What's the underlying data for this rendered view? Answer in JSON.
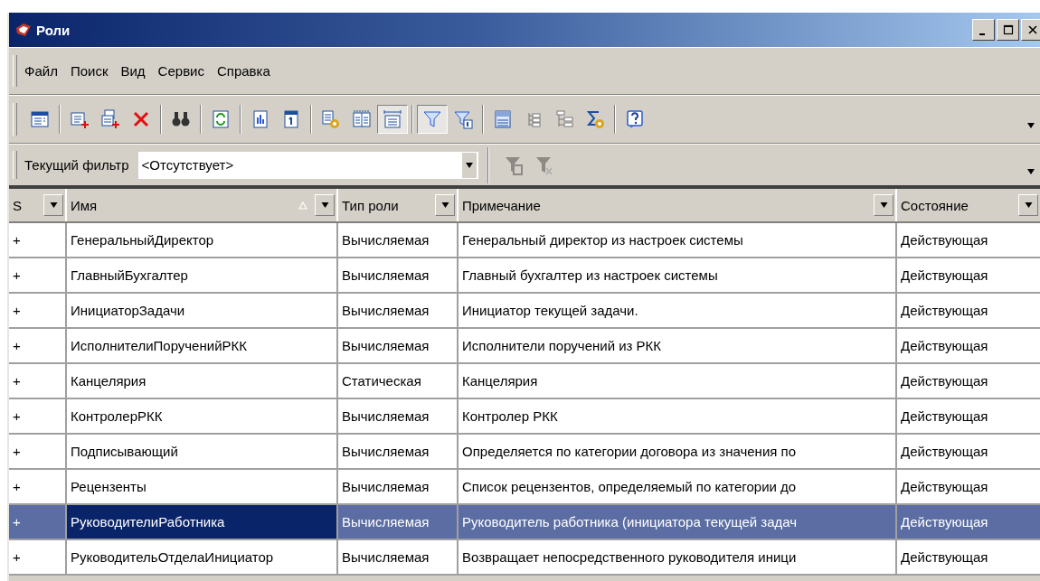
{
  "window": {
    "title": "Роли"
  },
  "menu": [
    {
      "label": "Файл"
    },
    {
      "label": "Поиск"
    },
    {
      "label": "Вид"
    },
    {
      "label": "Сервис"
    },
    {
      "label": "Справка"
    }
  ],
  "toolbar": [
    {
      "kind": "table",
      "pressed": false
    },
    {
      "kind": "separator"
    },
    {
      "kind": "add",
      "pressed": false
    },
    {
      "kind": "add-copy",
      "pressed": false
    },
    {
      "kind": "delete",
      "pressed": false
    },
    {
      "kind": "separator"
    },
    {
      "kind": "find",
      "pressed": false
    },
    {
      "kind": "separator"
    },
    {
      "kind": "refresh",
      "pressed": false
    },
    {
      "kind": "separator"
    },
    {
      "kind": "report",
      "pressed": false
    },
    {
      "kind": "calendar",
      "pressed": false
    },
    {
      "kind": "separator"
    },
    {
      "kind": "list-settings",
      "pressed": false
    },
    {
      "kind": "columns",
      "pressed": false
    },
    {
      "kind": "fit-width",
      "pressed": true
    },
    {
      "kind": "separator"
    },
    {
      "kind": "filter",
      "pressed": true
    },
    {
      "kind": "filter-value",
      "pressed": false
    },
    {
      "kind": "separator"
    },
    {
      "kind": "list",
      "pressed": false
    },
    {
      "kind": "tree",
      "pressed": false
    },
    {
      "kind": "tree-branch",
      "pressed": false
    },
    {
      "kind": "sigma",
      "pressed": false
    },
    {
      "kind": "separator"
    },
    {
      "kind": "help",
      "pressed": false
    }
  ],
  "filter_bar": {
    "label": "Текущий фильтр",
    "value": "<Отсутствует>",
    "set_filter_disabled": true,
    "clear_filter_disabled": true
  },
  "table": {
    "columns": [
      {
        "label": "S",
        "sorted_ascending": false
      },
      {
        "label": "Имя",
        "sorted_ascending": true
      },
      {
        "label": "Тип роли",
        "sorted_ascending": false
      },
      {
        "label": "Примечание",
        "sorted_ascending": false
      },
      {
        "label": "Состояние",
        "sorted_ascending": false
      }
    ],
    "rows": [
      {
        "s": "+",
        "name": "ГенеральныйДиректор",
        "type": "Вычисляемая",
        "note": "Генеральный директор из настроек системы",
        "state": "Действующая",
        "selected": false
      },
      {
        "s": "+",
        "name": "ГлавныйБухгалтер",
        "type": "Вычисляемая",
        "note": "Главный бухгалтер из настроек системы",
        "state": "Действующая",
        "selected": false
      },
      {
        "s": "+",
        "name": "ИнициаторЗадачи",
        "type": "Вычисляемая",
        "note": "Инициатор текущей задачи.",
        "state": "Действующая",
        "selected": false
      },
      {
        "s": "+",
        "name": "ИсполнителиПорученийРКК",
        "type": "Вычисляемая",
        "note": "Исполнители поручений из РКК",
        "state": "Действующая",
        "selected": false
      },
      {
        "s": "+",
        "name": "Канцелярия",
        "type": "Статическая",
        "note": "Канцелярия",
        "state": "Действующая",
        "selected": false
      },
      {
        "s": "+",
        "name": "КонтролерРКК",
        "type": "Вычисляемая",
        "note": "Контролер РКК",
        "state": "Действующая",
        "selected": false
      },
      {
        "s": "+",
        "name": "Подписывающий",
        "type": "Вычисляемая",
        "note": "Определяется по категории договора из значения по",
        "state": "Действующая",
        "selected": false
      },
      {
        "s": "+",
        "name": "Рецензенты",
        "type": "Вычисляемая",
        "note": "Список рецензентов, определяемый по категории до",
        "state": "Действующая",
        "selected": false
      },
      {
        "s": "+",
        "name": "РуководителиРаботника",
        "type": "Вычисляемая",
        "note": "Руководитель работника (инициатора текущей задач",
        "state": "Действующая",
        "selected": true
      },
      {
        "s": "+",
        "name": "РуководительОтделаИнициатор",
        "type": "Вычисляемая",
        "note": "Возвращает непосредственного руководителя иници",
        "state": "Действующая",
        "selected": false
      }
    ]
  }
}
